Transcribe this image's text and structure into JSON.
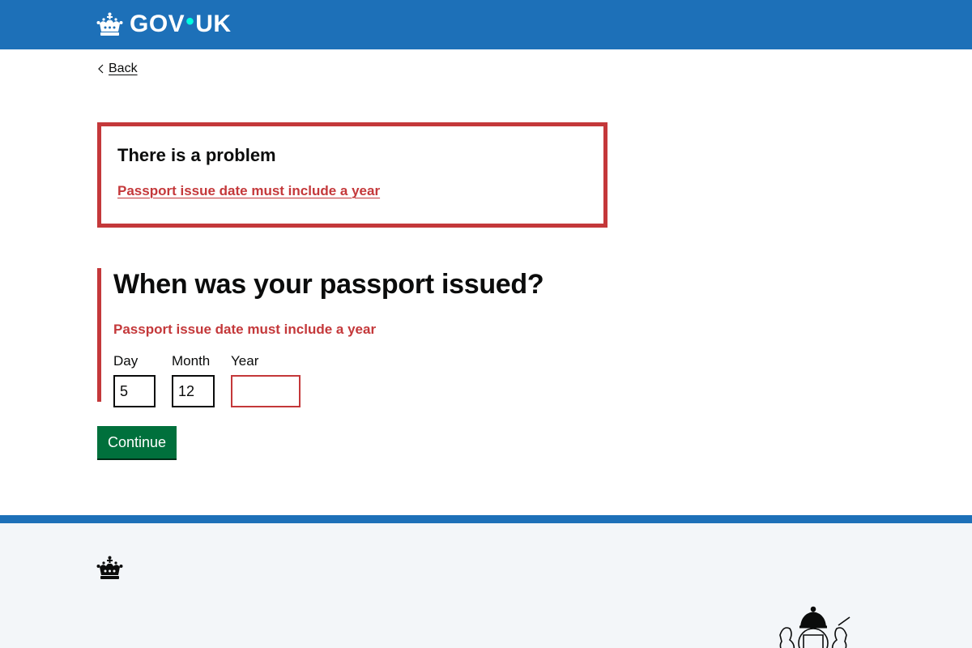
{
  "header": {
    "logo_word_left": "GOV",
    "logo_dot": "•",
    "logo_word_right": "UK",
    "logo_icon": "crown-icon"
  },
  "back_link": {
    "label": "Back",
    "icon": "chevron-left-icon"
  },
  "error_summary": {
    "title": "There is a problem",
    "errors": [
      "Passport issue date must include a year"
    ]
  },
  "question": {
    "heading": "When was your passport issued?",
    "error_message": "Passport issue date must include a year",
    "fields": [
      {
        "label": "Day",
        "value": "5"
      },
      {
        "label": "Month",
        "value": "12"
      },
      {
        "label": "Year",
        "value": ""
      }
    ]
  },
  "continue_button": {
    "label": "Continue"
  },
  "footer": {
    "logo_icon": "crown-icon",
    "crest_icon": "royal-coat-of-arms-icon"
  },
  "colors": {
    "header_blue": "#1d70b8",
    "error_red": "#c4383a",
    "button_green": "#00703c",
    "footer_bg": "#f3f6f9"
  }
}
